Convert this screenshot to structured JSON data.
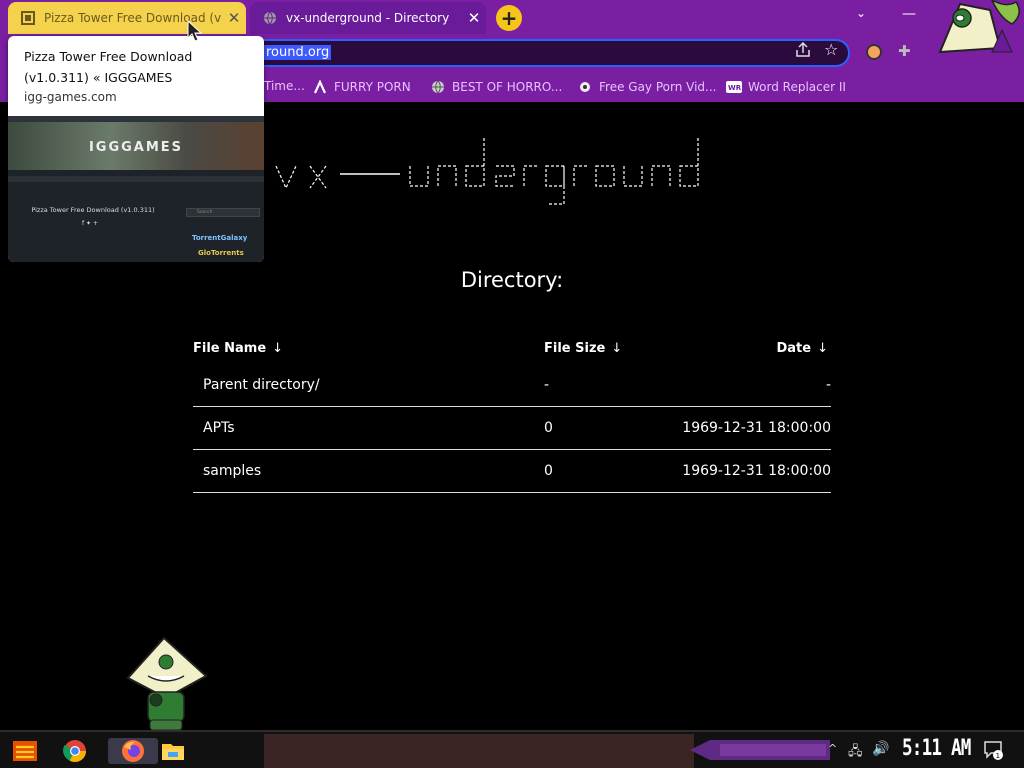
{
  "browser": {
    "tabs": [
      {
        "title": "Pizza Tower Free Download (v1.0.311) « IGGGAMES",
        "close": "✕",
        "active": false
      },
      {
        "title": "vx-underground - Directory",
        "close": "✕",
        "active": true
      }
    ],
    "new_tab": "+",
    "omnibox_url": "round.org",
    "bookmarks": [
      {
        "label": "Time...",
        "icon": "bookmark-icon"
      },
      {
        "label": "FURRY PORN",
        "icon": "lambda-icon"
      },
      {
        "label": "BEST OF HORRO...",
        "icon": "globe-icon"
      },
      {
        "label": "Free Gay Porn Vid...",
        "icon": "site-icon"
      },
      {
        "label": "Word Replacer II",
        "icon": "wr-icon"
      }
    ],
    "accent_color": "#7b1fa2"
  },
  "hover_card": {
    "title": "Pizza Tower Free Download (v1.0.311) « IGGGAMES",
    "domain": "igg-games.com",
    "preview": {
      "brand": "IGGGAMES",
      "page_title": "Pizza Tower Free Download (v1.0.311)",
      "search_placeholder": "Search",
      "sidebar_links": [
        "TorrentGalaxy",
        "GloTorrents"
      ]
    }
  },
  "page": {
    "banner_text": "vx-underground",
    "heading": "Directory:",
    "table": {
      "columns": [
        {
          "label": "File Name",
          "sort": "↓"
        },
        {
          "label": "File Size",
          "sort": "↓"
        },
        {
          "label": "Date",
          "sort": "↓"
        }
      ],
      "rows": [
        {
          "name": "Parent directory/",
          "size": "-",
          "date": "-"
        },
        {
          "name": "APTs",
          "size": "0",
          "date": "1969-12-31 18:00:00"
        },
        {
          "name": "samples",
          "size": "0",
          "date": "1969-12-31 18:00:00"
        }
      ]
    }
  },
  "taskbar": {
    "clock": "5:11 AM",
    "notification_count": "1",
    "pinned": [
      "start-icon",
      "chrome-icon",
      "firefox-icon",
      "file-explorer-icon"
    ]
  }
}
